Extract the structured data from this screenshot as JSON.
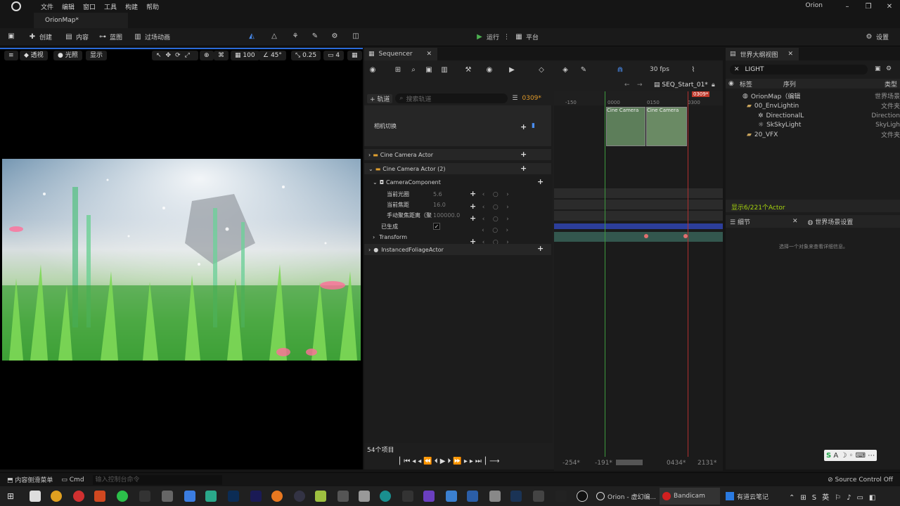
{
  "menu": {
    "items": [
      "文件",
      "编辑",
      "窗口",
      "工具",
      "构建",
      "帮助"
    ],
    "user": "Orion",
    "doc_tab": "OrionMap*"
  },
  "toolbar": {
    "create": "创建",
    "content": "内容",
    "blueprint": "蓝图",
    "cinematics": "过场动画",
    "run": "运行",
    "platform": "平台",
    "settings": "设置"
  },
  "viewport": {
    "perspective": "透视",
    "lit": "光照",
    "show": "显示",
    "grid": "100",
    "angle": "45°",
    "scale": "0.25",
    "cam": "4"
  },
  "sequencer": {
    "tab": "Sequencer",
    "fps": "30 fps",
    "seq_name": "SEQ_Start_01*",
    "add_track": "轨道",
    "search_placeholder": "搜索轨道",
    "frame": "0309*",
    "tracks": {
      "camera_cut": "相机切换",
      "cine1": "Cine Camera Actor",
      "cine2": "Cine Camera Actor (2)",
      "cam_comp": "CameraComponent",
      "aperture": "当前光圈",
      "aperture_val": "5.6",
      "focal": "当前焦距",
      "focal_val": "16.0",
      "focus": "手动聚焦距离（聚",
      "focus_val": "100000.0",
      "spawned": "已生成",
      "transform": "Transform",
      "foliage": "InstancedFoliageActor"
    },
    "item_count": "54个项目",
    "ruler": [
      "-150",
      "0000",
      "0150",
      "0300"
    ],
    "clip_labels": [
      "Cine Camera",
      "Cine Camera"
    ],
    "range": {
      "start": "-254*",
      "mid": "-191*",
      "end": "0434*",
      "max": "2131*"
    }
  },
  "outliner": {
    "tab": "世界大纲视图",
    "search_value": "LIGHT",
    "col_label": "标签",
    "col_seq": "序列",
    "col_type": "类型",
    "rows": [
      {
        "name": "OrionMap（编辑",
        "type": "世界场景"
      },
      {
        "name": "00_EnvLightin",
        "type": "文件夹"
      },
      {
        "name": "DirectionalL",
        "type": "Direction"
      },
      {
        "name": "SkSkyLight",
        "type": "SkyLigh"
      },
      {
        "name": "20_VFX",
        "type": "文件夹"
      }
    ],
    "status": "显示6/221个Actor"
  },
  "details": {
    "tab": "细节",
    "tab2": "世界场景设置",
    "empty": "选择一个对象来查看详细信息。"
  },
  "statusbar": {
    "drawer": "内容侧滑菜单",
    "cmd": "Cmd",
    "cmd_placeholder": "输入控制台命令",
    "source_control": "Source Control Off"
  },
  "taskbar": {
    "orion": "Orion - 虚幻编...",
    "bandicam": "Bandicam",
    "notes": "有道云笔记"
  },
  "colors": {
    "accent": "#2a6ad8",
    "play": "#4caf50",
    "highlight": "#a6d40e",
    "playhead": "#c0392b"
  }
}
